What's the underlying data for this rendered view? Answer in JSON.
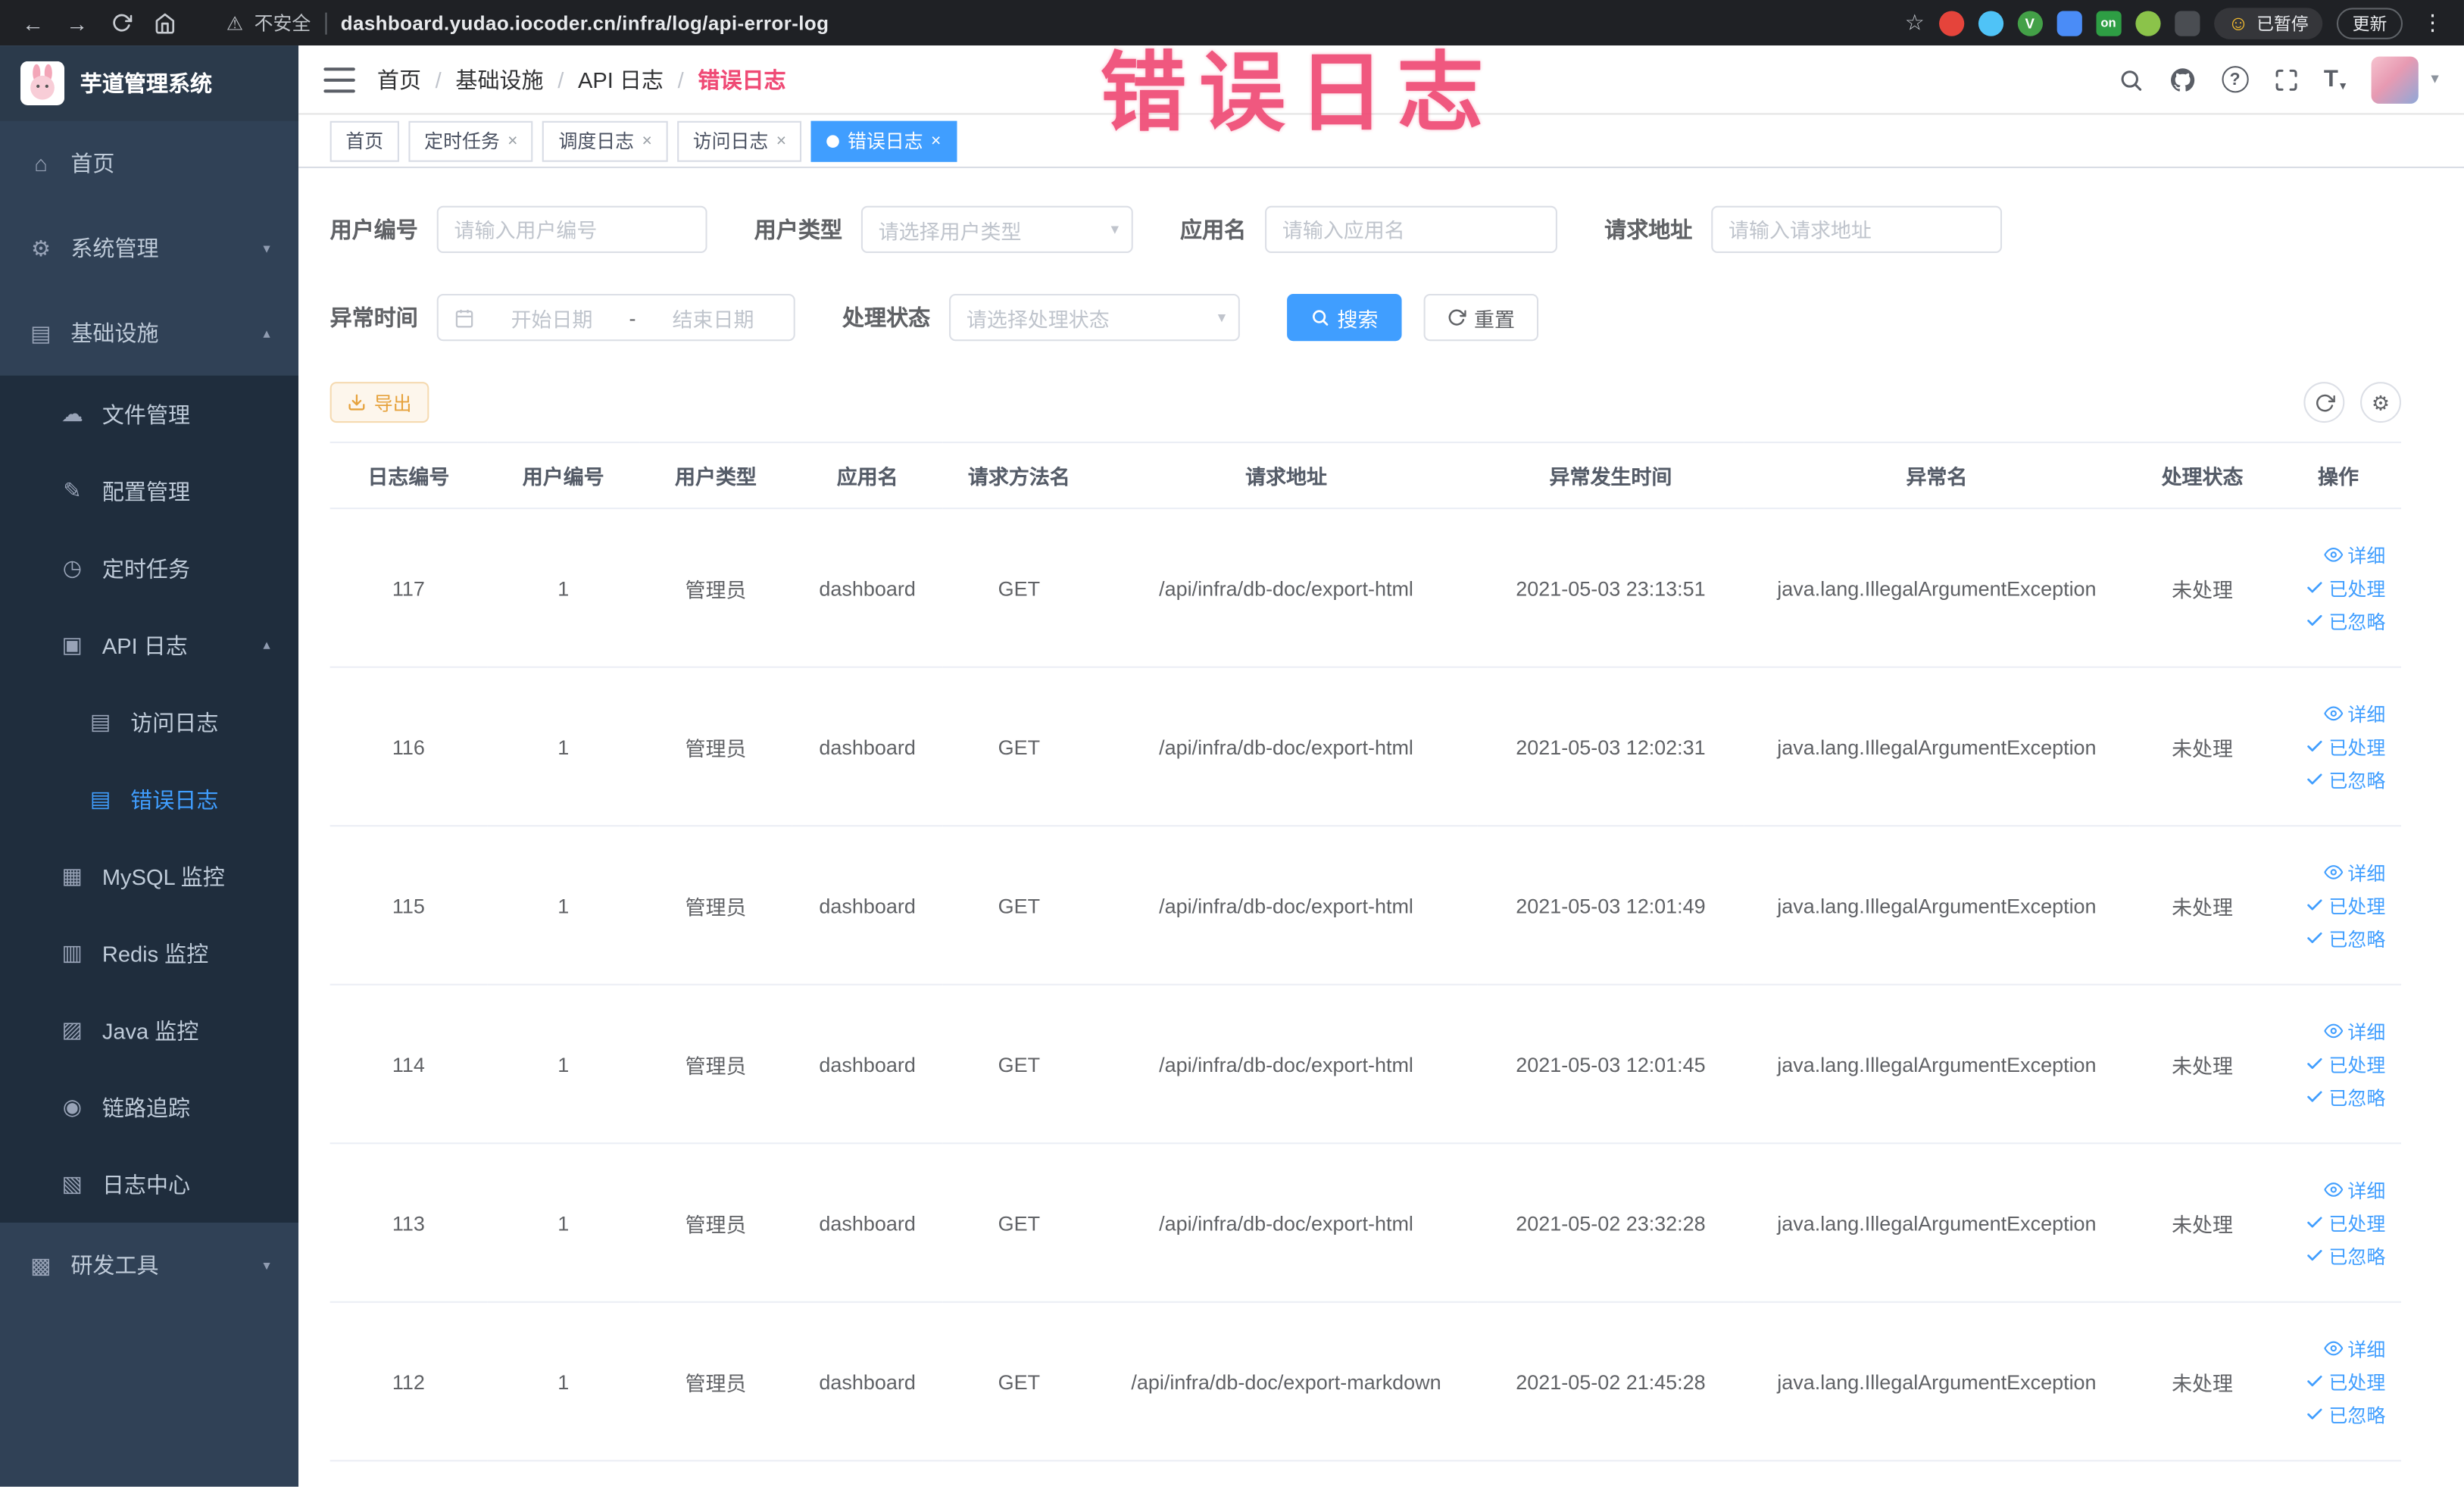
{
  "browser": {
    "security_label": "不安全",
    "url": "dashboard.yudao.iocoder.cn/infra/log/api-error-log",
    "paused_label": "已暂停",
    "update_label": "更新",
    "extension_badge_on": "on",
    "extension_badge_v": "V"
  },
  "annotation": {
    "text": "错误日志"
  },
  "sidebar": {
    "logo_title": "芋道管理系统",
    "items": [
      {
        "label": "首页"
      },
      {
        "label": "系统管理"
      },
      {
        "label": "基础设施"
      },
      {
        "label": "文件管理"
      },
      {
        "label": "配置管理"
      },
      {
        "label": "定时任务"
      },
      {
        "label": "API 日志"
      },
      {
        "label": "访问日志"
      },
      {
        "label": "错误日志"
      },
      {
        "label": "MySQL 监控"
      },
      {
        "label": "Redis 监控"
      },
      {
        "label": "Java 监控"
      },
      {
        "label": "链路追踪"
      },
      {
        "label": "日志中心"
      },
      {
        "label": "研发工具"
      }
    ]
  },
  "header": {
    "breadcrumb": [
      "首页",
      "基础设施",
      "API 日志",
      "错误日志"
    ],
    "separator": "/"
  },
  "tabs": [
    {
      "label": "首页"
    },
    {
      "label": "定时任务"
    },
    {
      "label": "调度日志"
    },
    {
      "label": "访问日志"
    },
    {
      "label": "错误日志"
    }
  ],
  "filters": {
    "user_id": {
      "label": "用户编号",
      "placeholder": "请输入用户编号"
    },
    "user_type": {
      "label": "用户类型",
      "placeholder": "请选择用户类型"
    },
    "app_name": {
      "label": "应用名",
      "placeholder": "请输入应用名"
    },
    "request_url": {
      "label": "请求地址",
      "placeholder": "请输入请求地址"
    },
    "exception_time": {
      "label": "异常时间",
      "start_placeholder": "开始日期",
      "separator": "-",
      "end_placeholder": "结束日期"
    },
    "process_status": {
      "label": "处理状态",
      "placeholder": "请选择处理状态"
    },
    "search_label": "搜索",
    "reset_label": "重置"
  },
  "toolbar": {
    "export_label": "导出"
  },
  "table": {
    "columns": [
      "日志编号",
      "用户编号",
      "用户类型",
      "应用名",
      "请求方法名",
      "请求地址",
      "异常发生时间",
      "异常名",
      "处理状态",
      "操作"
    ],
    "op_labels": {
      "detail": "详细",
      "processed": "已处理",
      "ignored": "已忽略"
    },
    "rows": [
      {
        "log_id": "117",
        "user_id": "1",
        "user_type": "管理员",
        "app_name": "dashboard",
        "method": "GET",
        "url": "/api/infra/db-doc/export-html",
        "time": "2021-05-03 23:13:51",
        "exception": "java.lang.IllegalArgumentException",
        "status": "未处理"
      },
      {
        "log_id": "116",
        "user_id": "1",
        "user_type": "管理员",
        "app_name": "dashboard",
        "method": "GET",
        "url": "/api/infra/db-doc/export-html",
        "time": "2021-05-03 12:02:31",
        "exception": "java.lang.IllegalArgumentException",
        "status": "未处理"
      },
      {
        "log_id": "115",
        "user_id": "1",
        "user_type": "管理员",
        "app_name": "dashboard",
        "method": "GET",
        "url": "/api/infra/db-doc/export-html",
        "time": "2021-05-03 12:01:49",
        "exception": "java.lang.IllegalArgumentException",
        "status": "未处理"
      },
      {
        "log_id": "114",
        "user_id": "1",
        "user_type": "管理员",
        "app_name": "dashboard",
        "method": "GET",
        "url": "/api/infra/db-doc/export-html",
        "time": "2021-05-03 12:01:45",
        "exception": "java.lang.IllegalArgumentException",
        "status": "未处理"
      },
      {
        "log_id": "113",
        "user_id": "1",
        "user_type": "管理员",
        "app_name": "dashboard",
        "method": "GET",
        "url": "/api/infra/db-doc/export-html",
        "time": "2021-05-02 23:32:28",
        "exception": "java.lang.IllegalArgumentException",
        "status": "未处理"
      },
      {
        "log_id": "112",
        "user_id": "1",
        "user_type": "管理员",
        "app_name": "dashboard",
        "method": "GET",
        "url": "/api/infra/db-doc/export-markdown",
        "time": "2021-05-02 21:45:28",
        "exception": "java.lang.IllegalArgumentException",
        "status": "未处理"
      }
    ]
  },
  "icons": {
    "back": "←",
    "forward": "→",
    "star": "☆",
    "warning": "⚠",
    "kebab": "⋮",
    "smiley": "☺",
    "question": "?",
    "font_size": "T",
    "caret_down": "▾",
    "chevron_down": "▾",
    "chevron_up": "▴",
    "close": "×",
    "gear": "⚙",
    "menu_home": "⌂",
    "menu_system": "⚙",
    "menu_infra": "▤",
    "menu_file": "☁",
    "menu_config": "✎",
    "menu_job": "◷",
    "menu_api_log": "▣",
    "menu_access_log": "▤",
    "menu_error_log": "▤",
    "menu_mysql": "▦",
    "menu_redis": "▥",
    "menu_java": "▨",
    "menu_trace": "◉",
    "menu_log_center": "▧",
    "menu_tools": "▩"
  }
}
